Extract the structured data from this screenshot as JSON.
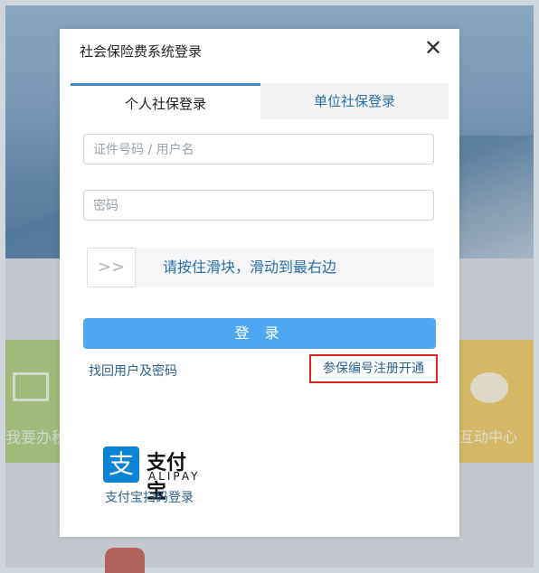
{
  "background": {
    "left_tile_text": "我要办税",
    "right_tile_text": "互动中心"
  },
  "dialog": {
    "title": "社会保险费系统登录",
    "close_symbol": "✕",
    "tabs": [
      {
        "label": "个人社保登录",
        "active": true
      },
      {
        "label": "单位社保登录",
        "active": false
      }
    ],
    "fields": {
      "username_placeholder": "证件号码 / 用户名",
      "password_placeholder": "密码"
    },
    "slider": {
      "handle": ">>",
      "prompt": "请按住滑块，滑动到最右边"
    },
    "login_button": "登 录",
    "forgot_link": "找回用户及密码",
    "register_link": "参保编号注册开通",
    "alipay": {
      "logo_char": "支",
      "logo_cn": "支付宝",
      "logo_en": "ALIPAY",
      "scan_login": "支付宝扫码登录"
    }
  },
  "colors": {
    "primary": "#4ea7f1",
    "link": "#2e5f8f",
    "highlight_border": "#e0231f",
    "alipay_blue": "#0b84d6"
  }
}
